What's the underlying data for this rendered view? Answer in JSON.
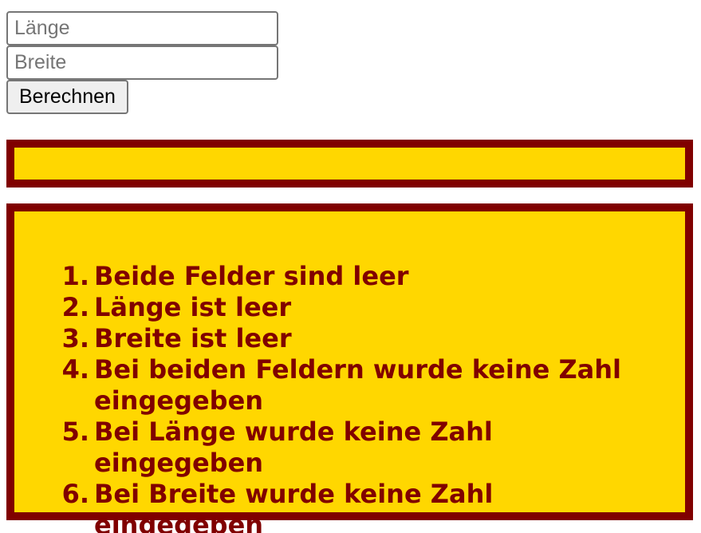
{
  "form": {
    "length_input": {
      "value": "",
      "placeholder": "Länge"
    },
    "width_input": {
      "value": "",
      "placeholder": "Breite"
    },
    "calculate_label": "Berechnen"
  },
  "result": {
    "text": ""
  },
  "errors": {
    "items": [
      "Beide Felder sind leer",
      "Länge ist leer",
      "Breite ist leer",
      "Bei beiden Feldern wurde keine Zahl eingegeben",
      "Bei Länge wurde keine Zahl eingegeben",
      "Bei Breite wurde keine Zahl eingegeben"
    ]
  },
  "colors": {
    "panel_background": "#ffd700",
    "panel_border": "#800000",
    "text": "#800000"
  }
}
